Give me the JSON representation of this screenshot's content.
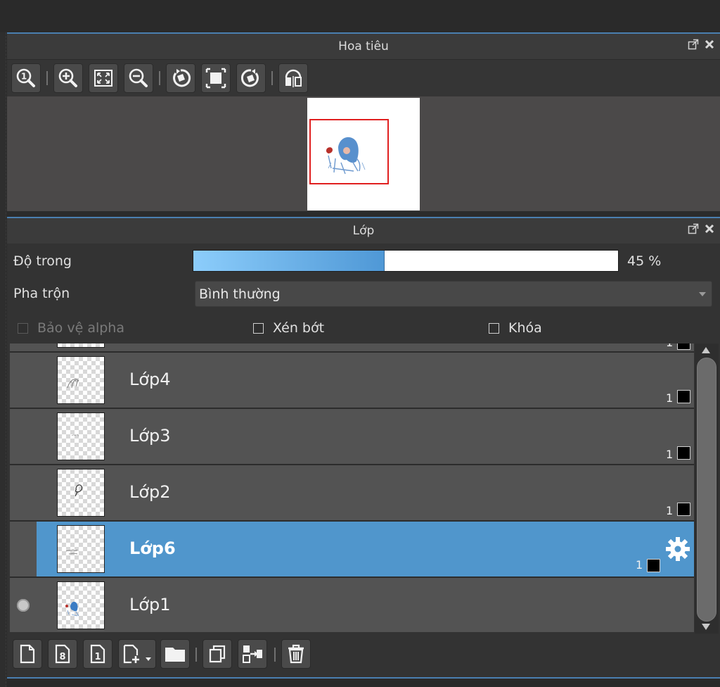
{
  "navigator": {
    "title": "Hoa tiêu",
    "tools": [
      {
        "icon": "zoom-actual-size-icon"
      },
      {
        "icon": "zoom-in-icon"
      },
      {
        "icon": "fit-to-window-icon"
      },
      {
        "icon": "zoom-out-icon"
      },
      {
        "icon": "rotate-left-icon"
      },
      {
        "icon": "reset-view-icon"
      },
      {
        "icon": "rotate-right-icon"
      },
      {
        "icon": "flip-horizontal-icon"
      }
    ],
    "frame_color": "#e02020"
  },
  "layers_panel": {
    "title": "Lớp",
    "opacity_label": "Độ trong",
    "opacity_value": 45,
    "opacity_text": "45 %",
    "blend_label": "Pha trộn",
    "blend_value": "Bình thường",
    "checkboxes": {
      "alpha": "Bảo vệ alpha",
      "clip": "Xén bớt",
      "lock": "Khóa"
    },
    "layers": [
      {
        "name": "Lớp4",
        "opacity": "1",
        "selected": false
      },
      {
        "name": "Lớp3",
        "opacity": "1",
        "selected": false
      },
      {
        "name": "Lớp2",
        "opacity": "1",
        "selected": false
      },
      {
        "name": "Lớp6",
        "opacity": "1",
        "selected": true
      },
      {
        "name": "Lớp1",
        "opacity": "",
        "selected": false
      }
    ],
    "partial_top_opacity": "1",
    "selected_color": "#5096cc",
    "bottom_tools": [
      {
        "icon": "new-layer-icon"
      },
      {
        "icon": "new-8bit-layer-icon"
      },
      {
        "icon": "new-1bit-layer-icon"
      },
      {
        "icon": "add-layer-menu-icon"
      },
      {
        "icon": "new-folder-icon"
      },
      {
        "icon": "duplicate-layer-icon"
      },
      {
        "icon": "merge-down-icon"
      },
      {
        "icon": "delete-layer-icon"
      }
    ]
  }
}
